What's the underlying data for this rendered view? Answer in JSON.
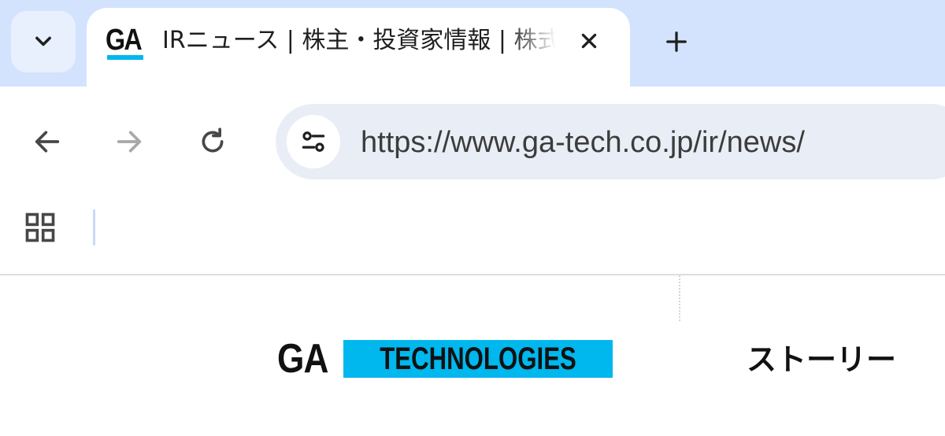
{
  "browser": {
    "tab": {
      "favicon_text": "GA",
      "title": "IRニュース | 株主・投資家情報 | 株式会社GA technologies"
    },
    "omnibox": {
      "url": "https://www.ga-tech.co.jp/ir/news/"
    },
    "icons": {
      "tab_search": "chevron-down-icon",
      "close_tab": "close-icon",
      "new_tab": "plus-icon",
      "back": "arrow-left-icon",
      "forward": "arrow-right-icon",
      "reload": "reload-icon",
      "site_info": "tune-icon",
      "apps": "apps-grid-icon"
    },
    "colors": {
      "tabstrip": "#d3e3fd",
      "omnibox": "#e9eef6",
      "brand_accent": "#00b7ee"
    }
  },
  "site": {
    "logo": {
      "ga": "GA",
      "technologies": "TECHNOLOGIES"
    },
    "nav": {
      "story": "ストーリー"
    }
  }
}
